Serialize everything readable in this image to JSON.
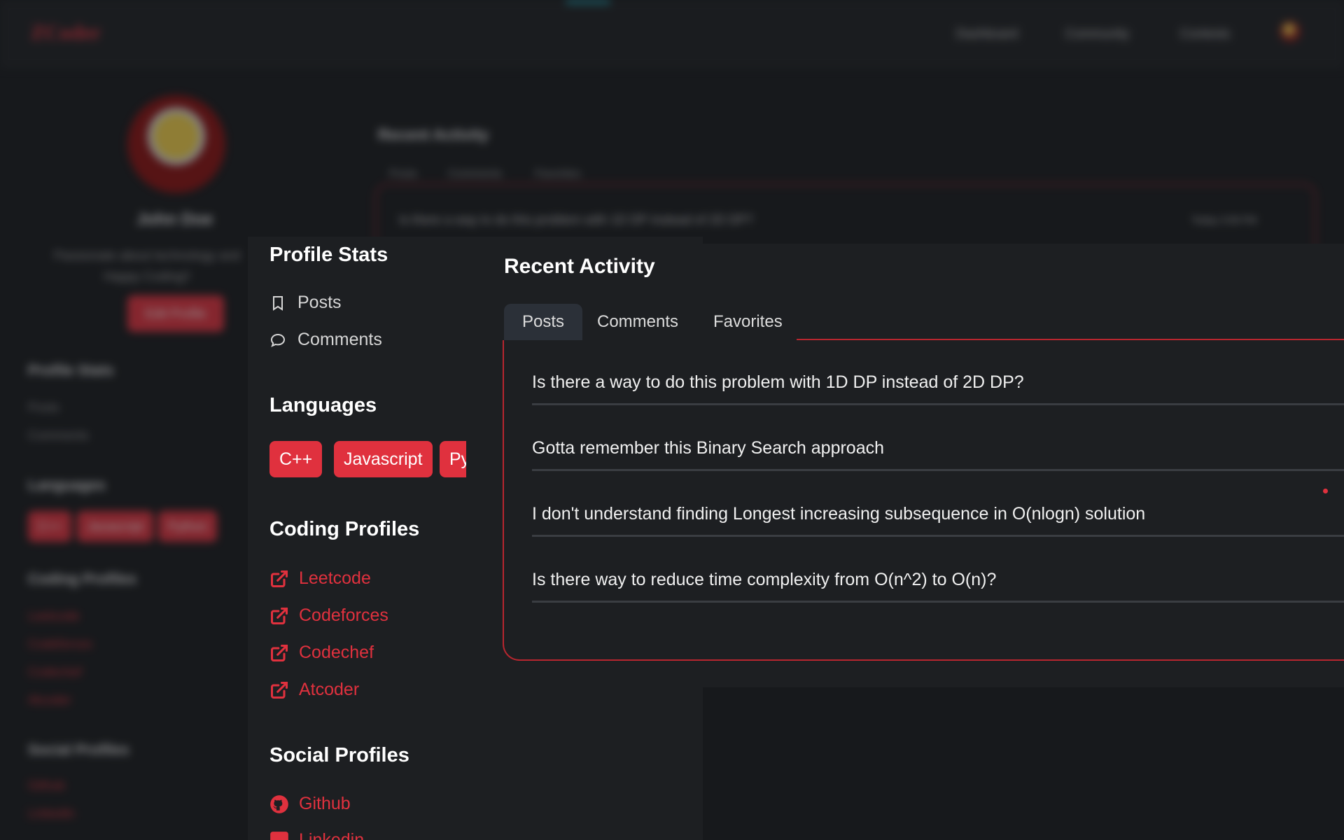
{
  "background": {
    "brand": "ZCoder",
    "nav": [
      "Dashboard",
      "Community",
      "Contests"
    ],
    "profile_name": "John Doe",
    "bio": "Passionate about technology and Happy Coding!!",
    "edit_button": "Edit Profile",
    "sections": {
      "stats": "Profile Stats",
      "languages": "Languages",
      "coding": "Coding Profiles",
      "social": "Social Profiles"
    },
    "stats": [
      "Posts",
      "Comments"
    ],
    "languages": [
      "C++",
      "Javascript",
      "Python"
    ],
    "coding_links": [
      "Leetcode",
      "Codeforces",
      "Codechef",
      "Atcoder"
    ],
    "social_links": [
      "Github",
      "Linkedin"
    ],
    "recent_title": "Recent Activity",
    "tabs": [
      "Posts",
      "Comments",
      "Favorites"
    ],
    "first_post": "Is there a way to do this problem with 1D DP instead of 2D DP?",
    "first_post_time": "Today 3:58 PM"
  },
  "sidebar": {
    "stats_title": "Profile Stats",
    "stats": [
      {
        "label": "Posts",
        "icon": "bookmark-icon"
      },
      {
        "label": "Comments",
        "icon": "comment-icon"
      }
    ],
    "languages_title": "Languages",
    "languages": [
      "C++",
      "Javascript",
      "Py"
    ],
    "coding_title": "Coding Profiles",
    "coding_links": [
      "Leetcode",
      "Codeforces",
      "Codechef",
      "Atcoder"
    ],
    "social_title": "Social Profiles",
    "social_links": [
      "Github",
      "Linkedin"
    ]
  },
  "main": {
    "title": "Recent Activity",
    "tabs": [
      {
        "label": "Posts",
        "active": true
      },
      {
        "label": "Comments",
        "active": false
      },
      {
        "label": "Favorites",
        "active": false
      }
    ],
    "posts": [
      "Is there a way to do this problem with 1D DP instead of 2D DP?",
      "Gotta remember this Binary Search approach",
      "I don't understand finding Longest increasing subsequence in O(nlogn) solution",
      "Is there way to reduce time complexity from O(n^2) to O(n)?"
    ]
  },
  "colors": {
    "accent": "#e0313e",
    "background": "#17191c",
    "panel": "#1d1f22",
    "active_tab": "#2b3038"
  }
}
